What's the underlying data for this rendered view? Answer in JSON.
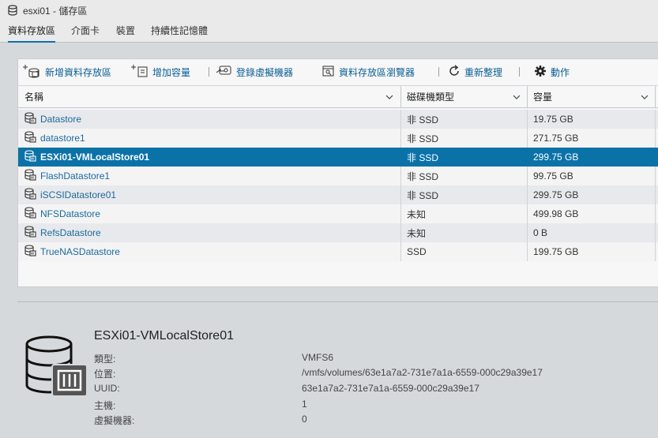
{
  "window": {
    "title": "esxi01 - 儲存區"
  },
  "tabs": [
    {
      "label": "資料存放區"
    },
    {
      "label": "介面卡"
    },
    {
      "label": "裝置"
    },
    {
      "label": "持續性記憶體"
    }
  ],
  "toolbar": {
    "new_datastore": "新增資料存放區",
    "increase_capacity": "增加容量",
    "register_vm": "登錄虛擬機器",
    "datastore_browser": "資料存放區瀏覽器",
    "refresh": "重新整理",
    "actions": "動作"
  },
  "table": {
    "columns": [
      "名稱",
      "磁碟機類型",
      "容量"
    ],
    "rows": [
      {
        "name": "Datastore",
        "type": "非 SSD",
        "capacity": "19.75 GB"
      },
      {
        "name": "datastore1",
        "type": "非 SSD",
        "capacity": "271.75 GB"
      },
      {
        "name": "ESXi01-VMLocalStore01",
        "type": "非 SSD",
        "capacity": "299.75 GB",
        "selected": true
      },
      {
        "name": "FlashDatastore1",
        "type": "非 SSD",
        "capacity": "99.75 GB"
      },
      {
        "name": "iSCSIDatastore01",
        "type": "非 SSD",
        "capacity": "299.75 GB"
      },
      {
        "name": "NFSDatastore",
        "type": "未知",
        "capacity": "499.98 GB"
      },
      {
        "name": "RefsDatastore",
        "type": "未知",
        "capacity": "0 B"
      },
      {
        "name": "TrueNASDatastore",
        "type": "SSD",
        "capacity": "199.75 GB"
      }
    ]
  },
  "details": {
    "title": "ESXi01-VMLocalStore01",
    "fields": [
      {
        "label": "類型:",
        "value": "VMFS6"
      },
      {
        "label": "位置:",
        "value": "/vmfs/volumes/63e1a7a2-731e7a1a-6559-000c29a39e17"
      },
      {
        "label": "UUID:",
        "value": "63e1a7a2-731e7a1a-6559-000c29a39e17"
      },
      {
        "label": "主機:",
        "value": "1"
      },
      {
        "label": "虛擬機器:",
        "value": "0"
      }
    ]
  },
  "colors": {
    "accent": "#0b72a8",
    "link": "#1b6a9c"
  }
}
